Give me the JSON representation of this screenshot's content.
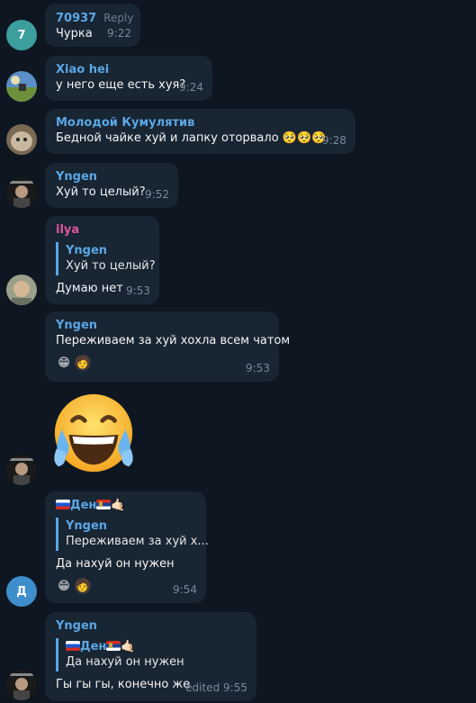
{
  "messages": [
    {
      "sender": "70937",
      "sender_color": "#5ba7e5",
      "reply_label": "Reply",
      "avatar_letter": "7",
      "avatar_color": "#3d9e9e",
      "text": "Чурка",
      "time": "9:22"
    },
    {
      "sender": "Xiao hei",
      "sender_color": "#5ba7e5",
      "text": "у него еще есть хуя?",
      "time": "9:24"
    },
    {
      "sender": "Молодой Кумулятив",
      "sender_color": "#5ba7e5",
      "text": "Бедной чайке хуй и лапку оторвало 🥺🥺🥺",
      "time": "9:28"
    },
    {
      "sender": "Yngen",
      "sender_color": "#5ba7e5",
      "text": "Хуй то целый?",
      "time": "9:52"
    },
    {
      "sender": "ilya",
      "sender_color": "#e0569b",
      "quote_name": "Yngen",
      "quote_text": "Хуй то целый?",
      "text": "Думаю нет",
      "time": "9:53"
    },
    {
      "sender": "Yngen",
      "sender_color": "#5ba7e5",
      "text": "Переживаем за хуй хохла всем чатом",
      "reactions": [
        "😁",
        "🧑"
      ],
      "time": "9:53"
    },
    {
      "sticker": "😂"
    },
    {
      "sender": "Ден",
      "sender_color": "#5ba7e5",
      "sender_suffix": "🤙🏻",
      "avatar_letter": "Д",
      "quote_name": "Yngen",
      "quote_text": "Переживаем за хуй х...",
      "text": "Да нахуй он нужен",
      "reactions": [
        "😁",
        "🧑"
      ],
      "time": "9:54"
    },
    {
      "sender": "Yngen",
      "sender_color": "#5ba7e5",
      "quote_name": "Ден",
      "quote_suffix": "🤙🏻",
      "quote_text": "Да нахуй он нужен",
      "text": "Гы гы гы, конечно же",
      "edited_label": "edited",
      "time": "9:55"
    }
  ]
}
